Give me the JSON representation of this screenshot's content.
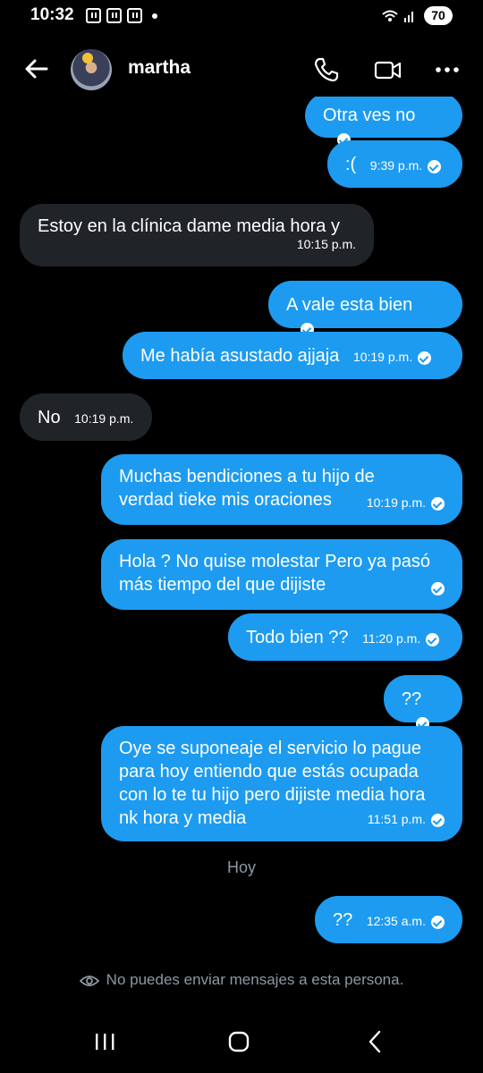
{
  "status_bar": {
    "time": "10:32",
    "battery": "70"
  },
  "header": {
    "contact_name": "martha"
  },
  "messages": [
    {
      "side": "out",
      "text": "Otra ves no",
      "time": ""
    },
    {
      "side": "out",
      "text": ":(",
      "time": "9:39 p.m."
    },
    {
      "side": "in",
      "text": "Estoy en la clínica dame media hora y",
      "time": "10:15 p.m."
    },
    {
      "side": "out",
      "text": "A vale esta bien",
      "time": ""
    },
    {
      "side": "out",
      "text": "Me había asustado ajjaja",
      "time": "10:19 p.m."
    },
    {
      "side": "in",
      "text": "No",
      "time": "10:19 p.m."
    },
    {
      "side": "out",
      "text": "Muchas bendiciones a tu hijo de verdad tieke mis oraciones",
      "time": "10:19 p.m."
    },
    {
      "side": "out",
      "text": "Hola ? No quise molestar Pero ya pasó más tiempo del que dijiste",
      "time": ""
    },
    {
      "side": "out",
      "text": "Todo bien ??",
      "time": "11:20 p.m."
    },
    {
      "side": "out",
      "text": "??",
      "time": ""
    },
    {
      "side": "out",
      "text": "Oye se suponeaje el servicio lo pague para hoy entiendo que estás ocupada con lo te tu hijo pero dijiste media hora nk hora y media",
      "time": "11:51 p.m."
    },
    {
      "side": "out",
      "text": "??",
      "time": "12:35 a.m."
    }
  ],
  "day_separator": "Hoy",
  "notice": "No puedes enviar mensajes a esta persona.",
  "colors": {
    "outgoing_bubble": "#1d9bf0",
    "incoming_bubble": "#202327",
    "background": "#000000",
    "muted_text": "#8b98a5"
  }
}
